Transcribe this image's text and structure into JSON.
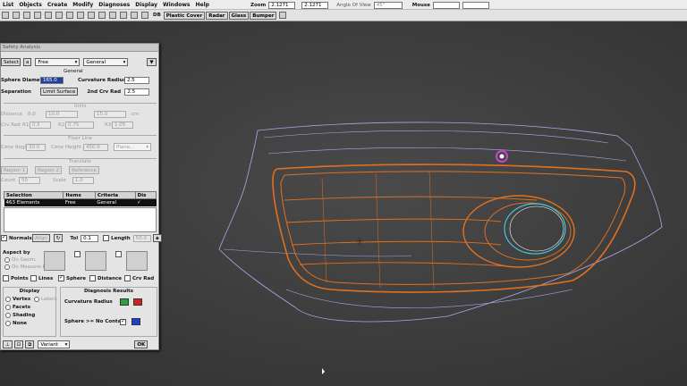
{
  "menubar": {
    "items": [
      "List",
      "Objects",
      "Create",
      "Modify",
      "Diagnoses",
      "Display",
      "Windows",
      "Help"
    ],
    "zoom_label": "Zoom",
    "zoom_x": "2.1271",
    "zoom_y": "2.1271",
    "angle_label": "Angle Of View",
    "angle_value": "45°",
    "mouse_label": "Mouse"
  },
  "toolbar": {
    "db_label": "DB",
    "tabs": [
      "Plastic Cover",
      "Radar",
      "Glass",
      "Bumper"
    ]
  },
  "panel": {
    "title": "Safety Analysis",
    "select_btn": "Select",
    "a_btn": "a",
    "mode_value": "Free",
    "type_value": "General",
    "general": "General",
    "sphere_label": "Sphere Diameter",
    "sphere_value": "165.0",
    "curv_label": "Curvature Radius",
    "curv_value": "2.5",
    "separation_label": "Separation",
    "limit_btn": "Limit Surface",
    "crv_label": "2nd Crv Rad",
    "crv_value": "2.5",
    "units": "Units",
    "distance_label": "Distance",
    "d1": "8.0",
    "d2": "10.0",
    "d3": "15.0",
    "d_unit": "cm",
    "crvrad_label": "Crv Rad",
    "r1_label": "R1",
    "r1": "0.5",
    "r2_label": "R2",
    "r2": "0.75",
    "r3_label": "R3",
    "r3": "1.05",
    "floorline": "Floor Line",
    "cone_label": "Cone Angle",
    "cone_value": "30.0",
    "coneh_label": "Cone Height",
    "coneh_value": "450.0",
    "plane_value": "Plane...",
    "translate": "Translate",
    "region1": "Region 1",
    "region2": "Region 2",
    "reference": "Reference",
    "count_label": "Count",
    "count_value": "50",
    "scale_label": "Scale",
    "scale_value": "1.0",
    "table": {
      "headers": [
        "Selection",
        "Items",
        "Criteria",
        "Dis"
      ],
      "row": [
        "463 Elements",
        "Free",
        "General",
        "✓"
      ]
    },
    "normals_label": "Normals",
    "align_btn": "Align",
    "tol_label": "Tol",
    "tol_value": "0.1",
    "length_label": "Length",
    "length_value": "50.0",
    "aspect_label": "Aspect by",
    "on_geom": "On Geom.",
    "on_measure": "On Measure P.",
    "points": "Points",
    "lines": "Lines",
    "sphere": "Sphere",
    "distance": "Distance",
    "crvrad": "Crv Rad",
    "display": "Display",
    "vertex": "Vertex",
    "labels": "Labels",
    "facets": "Facets",
    "shading": "Shading",
    "none": "None",
    "diag": "Diagnosis Results",
    "diag_curv": "Curvature Radius",
    "diag_sphere": "Sphere >= No Contact",
    "variant_value": "Variant",
    "ok_btn": "OK"
  },
  "colors": {
    "green": "#2ea043",
    "red": "#d02020",
    "blue": "#2040d0",
    "orange": "#e07020",
    "cyan": "#40c8e0",
    "magenta": "#c040c0"
  }
}
